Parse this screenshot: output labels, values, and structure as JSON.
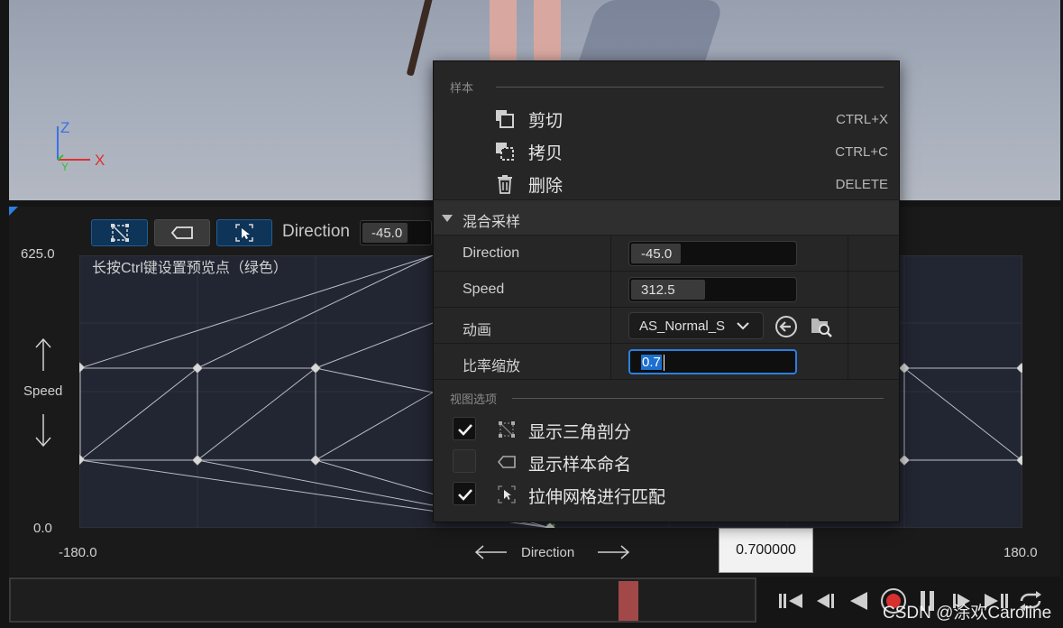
{
  "viewport": {
    "axis_z": "Z",
    "axis_x": "X",
    "axis_y": "Y"
  },
  "toolbar": {
    "direction_label": "Direction",
    "direction_value": "-45.0"
  },
  "graph": {
    "hint": "长按Ctrl键设置预览点（绿色）",
    "y_max": "625.0",
    "y_min": "0.0",
    "y_axis_label": "Speed",
    "x_min": "-180.0",
    "x_max": "180.0",
    "x_axis_label": "Direction"
  },
  "tooltip": {
    "value": "0.700000"
  },
  "menu": {
    "section_samples": "样本",
    "items": [
      {
        "label": "剪切",
        "shortcut": "CTRL+X",
        "icon": "cut-icon"
      },
      {
        "label": "拷贝",
        "shortcut": "CTRL+C",
        "icon": "copy-icon"
      },
      {
        "label": "删除",
        "shortcut": "DELETE",
        "icon": "trash-icon"
      }
    ],
    "blend_section": "混合采样",
    "props": {
      "direction_name": "Direction",
      "direction_value": "-45.0",
      "direction_fill": 0.3,
      "speed_name": "Speed",
      "speed_value": "312.5",
      "speed_fill": 0.45,
      "anim_name": "动画",
      "anim_value": "AS_Normal_S",
      "rate_name": "比率缩放",
      "rate_value": "0.7"
    },
    "section_view": "视图选项",
    "options": [
      {
        "label": "显示三角剖分",
        "checked": true
      },
      {
        "label": "显示样本命名",
        "checked": false
      },
      {
        "label": "拉伸网格进行匹配",
        "checked": true
      }
    ]
  },
  "watermark": "CSDN @涂欢Caroline",
  "colors": {
    "accent": "#2a7fe0",
    "timeline_marker": "#a24848",
    "axis_x": "#e03030",
    "axis_y": "#30c030",
    "axis_z": "#3a70e8"
  }
}
